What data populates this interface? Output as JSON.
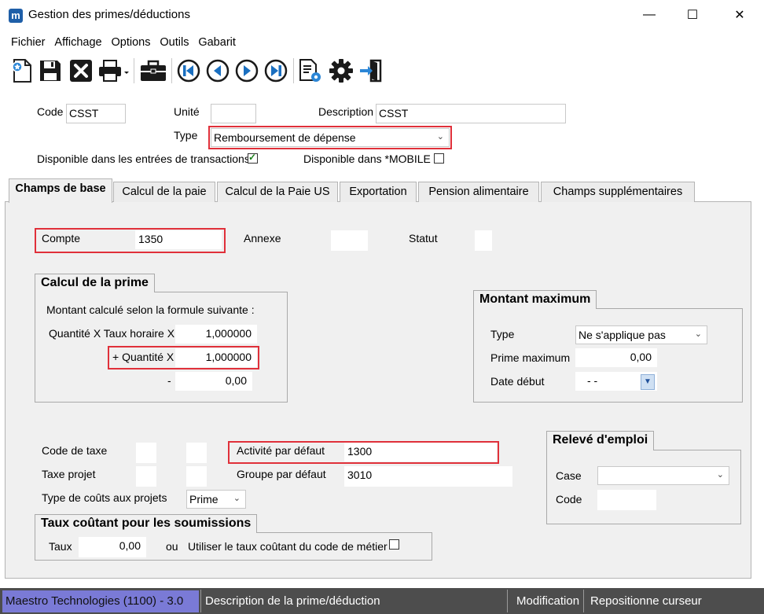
{
  "window": {
    "title": "Gestion des primes/déductions",
    "logo": "m",
    "minimize_glyph": "—",
    "maximize_glyph": "☐",
    "close_glyph": "✕"
  },
  "menu": [
    "Fichier",
    "Affichage",
    "Options",
    "Outils",
    "Gabarit"
  ],
  "toolbar": [
    "new-icon",
    "save-icon",
    "delete-icon",
    "print-icon",
    "briefcase-icon",
    "first-record-icon",
    "previous-record-icon",
    "next-record-icon",
    "last-record-icon",
    "document-settings-icon",
    "settings-gear-icon",
    "exit-icon"
  ],
  "header": {
    "code_label": "Code",
    "code_value": "CSST",
    "unite_label": "Unité",
    "unite_value": "",
    "description_label": "Description",
    "description_value": "CSST",
    "type_label": "Type",
    "type_value": "Remboursement de dépense",
    "dispo_transactions_label": "Disponible dans les entrées de transactions",
    "dispo_transactions_checked": true,
    "dispo_mobile_label": "Disponible dans *MOBILE",
    "dispo_mobile_checked": false
  },
  "tabs": [
    {
      "label": "Champs de base",
      "active": true
    },
    {
      "label": "Calcul de la paie",
      "active": false
    },
    {
      "label": "Calcul de la Paie US",
      "active": false
    },
    {
      "label": "Exportation",
      "active": false
    },
    {
      "label": "Pension alimentaire",
      "active": false
    },
    {
      "label": "Champs supplémentaires",
      "active": false
    }
  ],
  "base": {
    "compte_label": "Compte",
    "compte_value": "1350",
    "annexe_label": "Annexe",
    "annexe_value": "",
    "statut_label": "Statut",
    "statut_value": ""
  },
  "calcul_prime": {
    "title": "Calcul de la prime",
    "intro": "Montant calculé selon la formule suivante :",
    "row1_label": "Quantité X Taux horaire X",
    "row1_value": "1,000000",
    "row2_label": "+ Quantité X",
    "row2_value": "1,000000",
    "row3_label": "-",
    "row3_value": "0,00"
  },
  "montant_max": {
    "title": "Montant maximum",
    "type_label": "Type",
    "type_value": "Ne s'applique pas",
    "prime_label": "Prime maximum",
    "prime_value": "0,00",
    "date_label": "Date début",
    "date_value": "-  -"
  },
  "taxes": {
    "code_taxe_label": "Code de taxe",
    "taxe_projet_label": "Taxe projet",
    "type_couts_label": "Type de coûts aux projets",
    "type_couts_value": "Prime",
    "activite_label": "Activité par défaut",
    "activite_value": "1300",
    "groupe_label": "Groupe par défaut",
    "groupe_value": "3010"
  },
  "releve": {
    "title": "Relevé d'emploi",
    "case_label": "Case",
    "case_value": "",
    "code_label": "Code",
    "code_value": ""
  },
  "taux": {
    "title": "Taux coûtant pour les soumissions",
    "taux_label": "Taux",
    "taux_value": "0,00",
    "ou_label": "ou",
    "utiliser_label": "Utiliser le taux coûtant du code de métier",
    "utiliser_checked": false
  },
  "statusbar": {
    "company": "Maestro Technologies (1100) - 3.0",
    "description": "Description de la prime/déduction",
    "mode": "Modification",
    "hint": "Repositionne curseur"
  },
  "colors": {
    "highlight_border": "#e0303a",
    "statusbar_bg": "#4d4d4d",
    "company_cell_bg": "#7a7ad6"
  }
}
